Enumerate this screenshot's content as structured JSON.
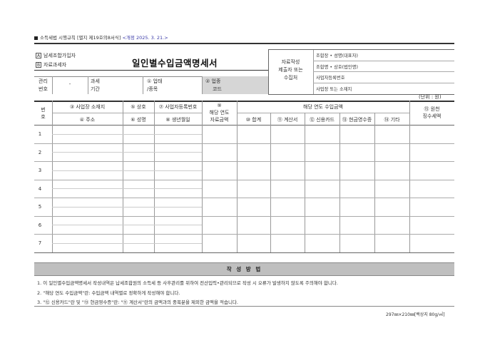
{
  "header": {
    "law_note": "소득세법 시행규칙 [별지 제19호의8서식]",
    "revision": "<개정 2025. 3. 21.>"
  },
  "form": {
    "checkbox_a_label": "남세조합가입자",
    "checkbox_a_mark": "A",
    "checkbox_b_label": "자료과세자",
    "checkbox_b_mark": "B",
    "title": "일인별수입금액명세서"
  },
  "submitter": {
    "label_line1": "자료작성",
    "label_line2": "제출자 또는",
    "label_line3": "수집처",
    "fields": [
      "조합장 • 성명(대표자)",
      "조합명 • 상호(법인명)",
      "사업자등록번호",
      "사업장 또는 소재지"
    ]
  },
  "meta_row": {
    "mgmt_no_1": "관리",
    "mgmt_no_2": "번호",
    "dash": "-",
    "period_1": "과세",
    "period_2": "기간",
    "business_1": "① 업태",
    "business_2": "/종목",
    "code_1": "② 업종",
    "code_2": "코드"
  },
  "unit": "(단위 : 원)",
  "columns": {
    "no_1": "번",
    "no_2": "호",
    "c3": "③ 사업장 소재지",
    "c4": "④ 주소",
    "c5": "⑤ 상호",
    "c6": "⑥ 성명",
    "c7": "⑦ 사업자등록번호",
    "c8": "⑧ 생년월일",
    "c9_1": "⑨",
    "c9_2": "해당 연도",
    "c9_3": "자료금액",
    "income_header": "해당 연도 수입금액",
    "c10": "⑩ 합계",
    "c11": "⑪ 계산서",
    "c12": "⑫ 신용카드",
    "c13": "⑬ 현금영수증",
    "c14": "⑭ 기타",
    "c15_1": "⑮ 원천",
    "c15_2": "징수세액"
  },
  "rows": [
    "1",
    "2",
    "3",
    "4",
    "5",
    "6",
    "7"
  ],
  "instructions": {
    "title": "작 성 방 법",
    "items": [
      "1. 이 일인별수입금액명세서 작성내역은 납세조합원의 소득세 등 사후관리를 위하여 전산입력•관리되므로 작성 시 오류가 발생하지 않도록 주의해야 합니다.",
      "2. \"해당 연도 수입금액\"란: 수입금액 내역별로 정확하게 작성해야 합니다.",
      "3. \"⑫ 신용카드\"란 및 \"⑬ 현금영수증\"란: \"⑪ 계산서\"란의 금액과의 중복분을 제외한 금액을 적습니다."
    ]
  },
  "paper_size": "297㎜×210㎜[백상지 80g/㎡]"
}
